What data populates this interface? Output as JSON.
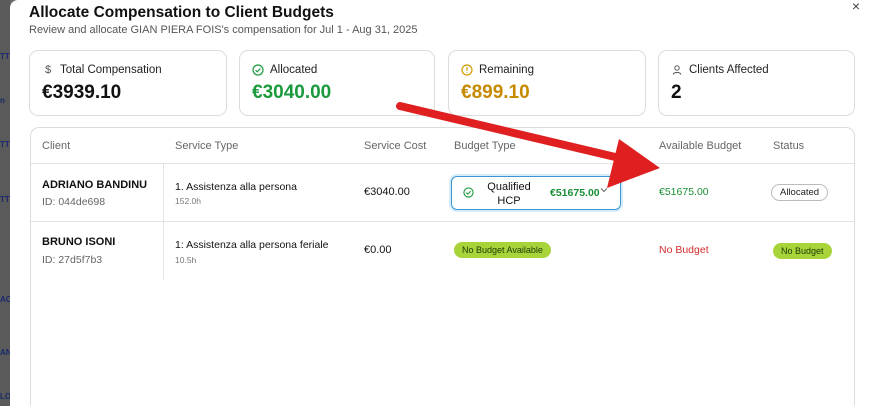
{
  "dialog": {
    "title": "Allocate Compensation to Client Budgets",
    "subtitle": "Review and allocate GIAN PIERA FOIS's compensation for Jul 1 - Aug 31, 2025",
    "close_icon": "×"
  },
  "summary": {
    "total": {
      "label": "Total Compensation",
      "value": "€3939.10",
      "icon": "dollar-icon",
      "color": "#111111"
    },
    "allocated": {
      "label": "Allocated",
      "value": "€3040.00",
      "icon": "check-circle-icon",
      "color": "#1a9a3c"
    },
    "remaining": {
      "label": "Remaining",
      "value": "€899.10",
      "icon": "alert-circle-icon",
      "color": "#c68a00"
    },
    "clients": {
      "label": "Clients Affected",
      "value": "2",
      "icon": "user-icon",
      "color": "#111111"
    }
  },
  "table": {
    "headers": {
      "client": "Client",
      "service_type": "Service Type",
      "service_cost": "Service Cost",
      "budget_type": "Budget Type",
      "available_budget": "Available Budget",
      "status": "Status"
    },
    "rows": [
      {
        "client_name": "ADRIANO BANDINU",
        "client_id": "ID: 044de698",
        "service": "1. Assistenza alla persona",
        "hours": "152.0h",
        "cost": "€3040.00",
        "budget_type": "Qualified HCP",
        "budget_amount": "€51675.00",
        "available": "€51675.00",
        "status": "Allocated"
      },
      {
        "client_name": "BRUNO ISONI",
        "client_id": "ID: 27d5f7b3",
        "service": "1: Assistenza alla persona feriale",
        "hours": "10.5h",
        "cost": "€0.00",
        "budget_type": "No Budget Available",
        "available": "No Budget",
        "status": "No Budget"
      }
    ]
  },
  "colors": {
    "green": "#1a9a3c",
    "amber": "#c68a00",
    "red": "#d22d2d",
    "lime_pill": "#a8d43a",
    "select_border": "#3a96d0",
    "annotation_arrow": "#e02020"
  }
}
